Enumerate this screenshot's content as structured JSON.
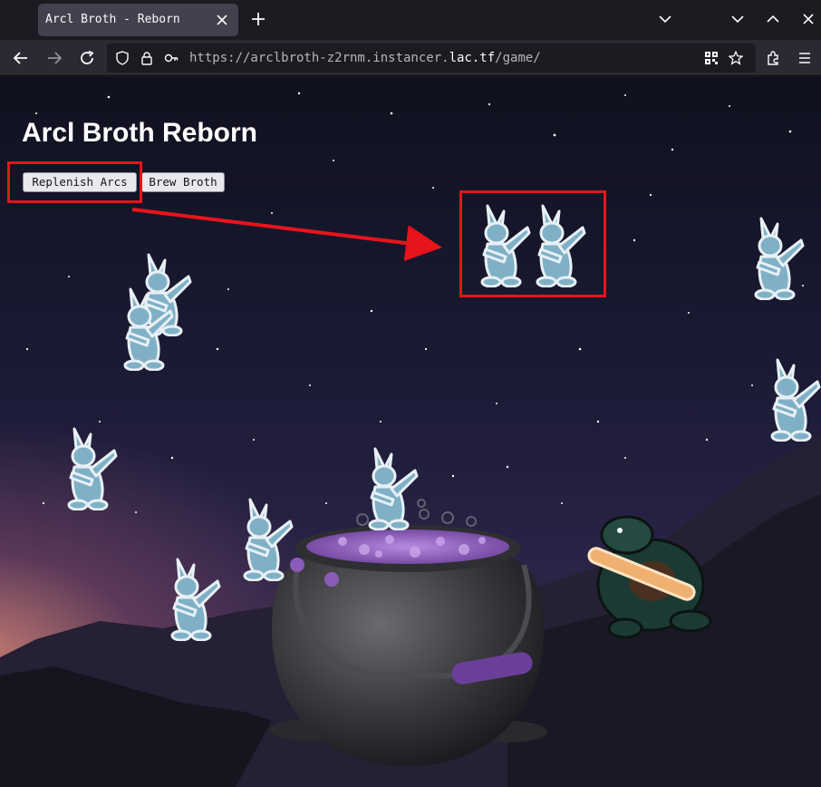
{
  "browser": {
    "tab_title": "Arcl Broth - Reborn",
    "url_prefix": "https://arclbroth-z2rnm.instancer.",
    "url_host": "lac.tf",
    "url_suffix": "/game/"
  },
  "page": {
    "title": "Arcl Broth Reborn",
    "buttons": {
      "replenish": "Replenish Arcs",
      "brew": "Brew Broth"
    }
  },
  "colors": {
    "annotation": "#e8141b",
    "arc_body": "#7fb0c6",
    "broth": "#9a6bc8",
    "cauldron": "#3a3a3f"
  },
  "icons": [
    "close-icon",
    "plus-icon",
    "chevron-down-icon",
    "minimize-icon",
    "maximize-icon",
    "back-arrow-icon",
    "forward-arrow-icon",
    "reload-icon",
    "shield-icon",
    "lock-icon",
    "key-icon",
    "qr-code-icon",
    "star-icon",
    "extensions-icon",
    "menu-icon"
  ]
}
